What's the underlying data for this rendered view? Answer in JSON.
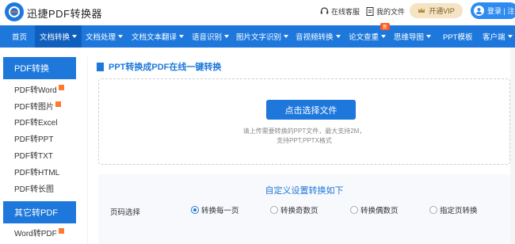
{
  "header": {
    "brand": "迅捷PDF转换器",
    "support": "在线客服",
    "my_files": "我的文件",
    "vip": "开通VIP",
    "login": "登录 | 注"
  },
  "nav": {
    "items": [
      {
        "label": "首页",
        "dropdown": false
      },
      {
        "label": "文档转换",
        "dropdown": true
      },
      {
        "label": "文档处理",
        "dropdown": true
      },
      {
        "label": "文档文本翻译",
        "dropdown": true
      },
      {
        "label": "语音识别",
        "dropdown": true
      },
      {
        "label": "图片文字识别",
        "dropdown": true
      },
      {
        "label": "音视频转换",
        "dropdown": true
      },
      {
        "label": "论文查重",
        "dropdown": true
      },
      {
        "label": "思维导图",
        "dropdown": true
      },
      {
        "label": "PPT模板",
        "dropdown": false
      },
      {
        "label": "客户端",
        "dropdown": true
      }
    ],
    "new_badge": "新"
  },
  "sidebar": {
    "section1": "PDF转换",
    "items": [
      {
        "label": "PDF转Word",
        "hot": true
      },
      {
        "label": "PDF转图片",
        "hot": true
      },
      {
        "label": "PDF转Excel",
        "hot": false
      },
      {
        "label": "PDF转PPT",
        "hot": false
      },
      {
        "label": "PDF转TXT",
        "hot": false
      },
      {
        "label": "PDF转HTML",
        "hot": false
      },
      {
        "label": "PDF转长图",
        "hot": false
      }
    ],
    "section2": "其它转PDF",
    "items2": [
      {
        "label": "Word转PDF",
        "hot": true
      }
    ]
  },
  "main": {
    "title": "PPT转换成PDF在线一键转换",
    "upload_button": "点击选择文件",
    "hint_line1": "请上传需要转换的PPT文件，最大支持2M，",
    "hint_line2": "支持PPT,PPTX格式"
  },
  "settings": {
    "title": "自定义设置转换如下",
    "page_label": "页码选择",
    "options": [
      {
        "label": "转换每一页",
        "selected": true
      },
      {
        "label": "转换奇数页",
        "selected": false
      },
      {
        "label": "转换偶数页",
        "selected": false
      },
      {
        "label": "指定页转换",
        "selected": false
      }
    ]
  },
  "colors": {
    "primary": "#1e78dc",
    "nav_active": "#0f5fbe",
    "vip_bg": "#f4e4c4",
    "hot_badge": "#ff7a2a"
  }
}
